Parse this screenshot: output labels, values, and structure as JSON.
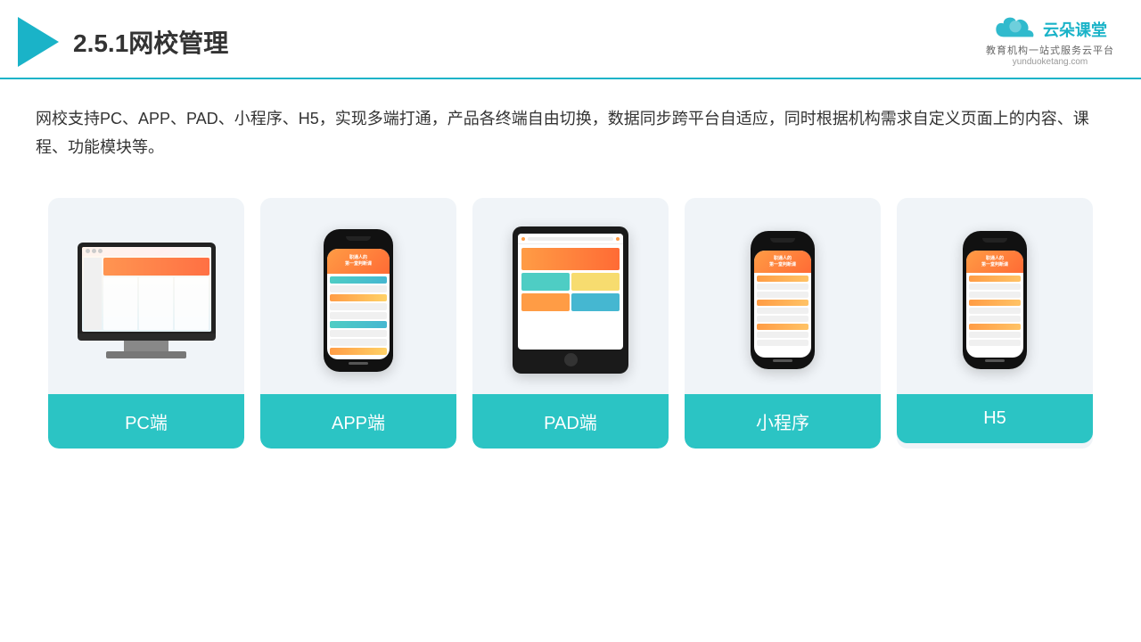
{
  "header": {
    "title": "2.5.1网校管理",
    "brand": {
      "name": "云朵课堂",
      "url": "yunduoketang.com",
      "tagline": "教育机构一站式服务云平台"
    }
  },
  "description": "网校支持PC、APP、PAD、小程序、H5，实现多端打通，产品各终端自由切换，数据同步跨平台自适应，同时根据机构需求自定义页面上的内容、课程、功能模块等。",
  "cards": [
    {
      "id": "pc",
      "label": "PC端"
    },
    {
      "id": "app",
      "label": "APP端"
    },
    {
      "id": "pad",
      "label": "PAD端"
    },
    {
      "id": "miniprogram",
      "label": "小程序"
    },
    {
      "id": "h5",
      "label": "H5"
    }
  ],
  "colors": {
    "accent": "#1ab3c8",
    "teal": "#2bc4c4",
    "text_dark": "#333333",
    "text_mid": "#666666",
    "card_bg": "#f0f4f8"
  }
}
